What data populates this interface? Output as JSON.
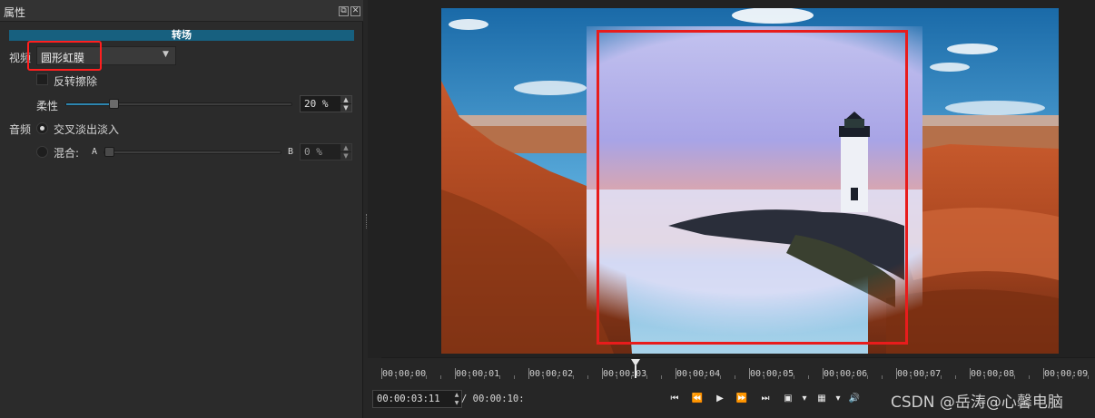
{
  "panel": {
    "title": "属性",
    "float_glyph": "⧉",
    "close_glyph": "✕",
    "section_title": "转场",
    "video": {
      "label": "视频",
      "transition_type": "圆形虹膜",
      "dropdown_icon": "chevron-down-icon",
      "invert_label": "反转擦除",
      "invert_checked": false,
      "softness_label": "柔性",
      "softness_value": "20 %",
      "softness_fraction": 0.2
    },
    "audio": {
      "label": "音频",
      "crossfade_label": "交叉淡出淡入",
      "crossfade_selected": true,
      "mix_label": "混合:",
      "mix_a": "A",
      "mix_b": "B",
      "mix_value": "0 %",
      "mix_fraction": 0.0
    },
    "highlight_color": "#ff1f1f"
  },
  "preview": {
    "annotation_color": "#e81c1c"
  },
  "timeline": {
    "ticks": [
      "00:00:00",
      "00:00:01",
      "00:00:02",
      "00:00:03",
      "00:00:04",
      "00:00:05",
      "00:00:06",
      "00:00:07",
      "00:00:08",
      "00:00:09"
    ],
    "playhead_time": "00:00:03"
  },
  "transport": {
    "position": "00:00:03:11",
    "duration": "/ 00:00:10:",
    "buttons": [
      {
        "name": "skip-to-start-icon",
        "glyph": "⏮"
      },
      {
        "name": "rewind-icon",
        "glyph": "⏪"
      },
      {
        "name": "play-icon",
        "glyph": "▶"
      },
      {
        "name": "fast-forward-icon",
        "glyph": "⏩"
      },
      {
        "name": "skip-to-end-icon",
        "glyph": "⏭"
      },
      {
        "name": "zoom-fit-icon",
        "glyph": "▣"
      },
      {
        "name": "zoom-dropdown-icon",
        "glyph": "▾"
      },
      {
        "name": "grid-icon",
        "glyph": "▦"
      },
      {
        "name": "grid-dropdown-icon",
        "glyph": "▾"
      },
      {
        "name": "volume-icon",
        "glyph": "🔊"
      }
    ]
  },
  "watermark": "CSDN @岳涛@心馨电脑"
}
